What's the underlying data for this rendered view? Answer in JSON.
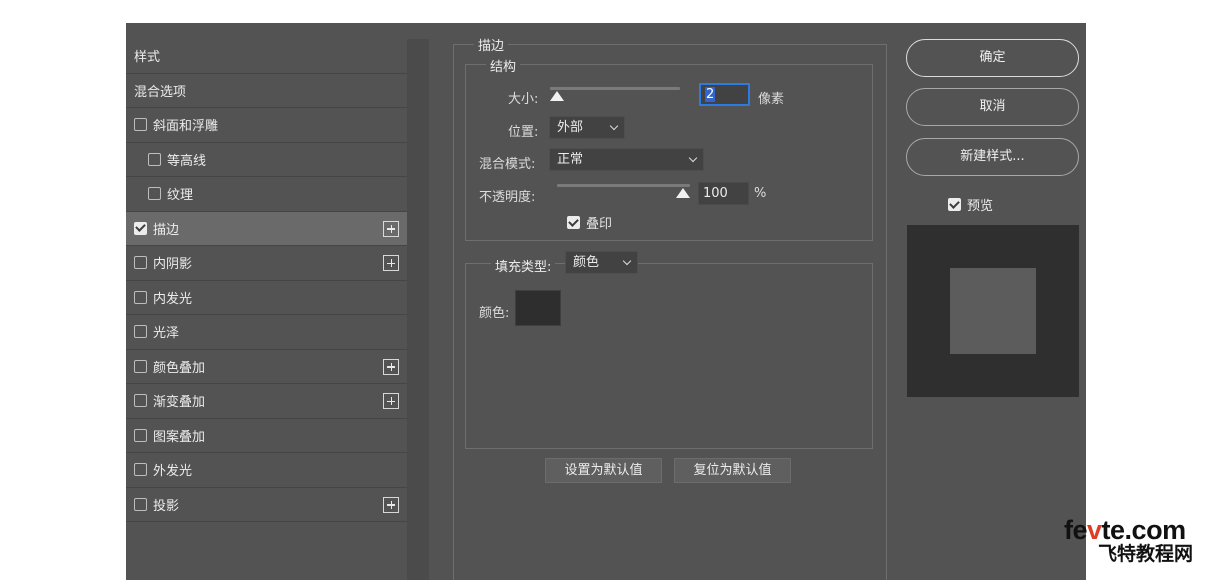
{
  "style_list": {
    "items": [
      {
        "label": "样式",
        "header": true
      },
      {
        "label": "混合选项",
        "header": true
      },
      {
        "label": "斜面和浮雕",
        "checked": false
      },
      {
        "label": "等高线",
        "checked": false,
        "indent": true
      },
      {
        "label": "纹理",
        "checked": false,
        "indent": true
      },
      {
        "label": "描边",
        "checked": true,
        "selected": true,
        "plus": true
      },
      {
        "label": "内阴影",
        "checked": false,
        "plus": true
      },
      {
        "label": "内发光",
        "checked": false
      },
      {
        "label": "光泽",
        "checked": false
      },
      {
        "label": "颜色叠加",
        "checked": false,
        "plus": true
      },
      {
        "label": "渐变叠加",
        "checked": false,
        "plus": true
      },
      {
        "label": "图案叠加",
        "checked": false
      },
      {
        "label": "外发光",
        "checked": false
      },
      {
        "label": "投影",
        "checked": false,
        "plus": true
      }
    ]
  },
  "panel": {
    "title": "描边",
    "structure": {
      "title": "结构",
      "size_label": "大小:",
      "size_value": "2",
      "size_unit": "像素",
      "position_label": "位置:",
      "position_value": "外部",
      "blend_label": "混合模式:",
      "blend_value": "正常",
      "opacity_label": "不透明度:",
      "opacity_value": "100",
      "opacity_unit": "%",
      "overprint_label": "叠印"
    },
    "fill": {
      "type_label": "填充类型:",
      "type_value": "颜色",
      "color_label": "颜色:",
      "color_hex": "#2e2e2e"
    },
    "set_default_label": "设置为默认值",
    "reset_default_label": "复位为默认值"
  },
  "buttons": {
    "ok": "确定",
    "cancel": "取消",
    "new_style": "新建样式...",
    "preview_label": "预览"
  },
  "watermark": {
    "top_a": "fe",
    "top_v": "v",
    "top_b": "te.com",
    "bottom": "飞特教程网"
  }
}
